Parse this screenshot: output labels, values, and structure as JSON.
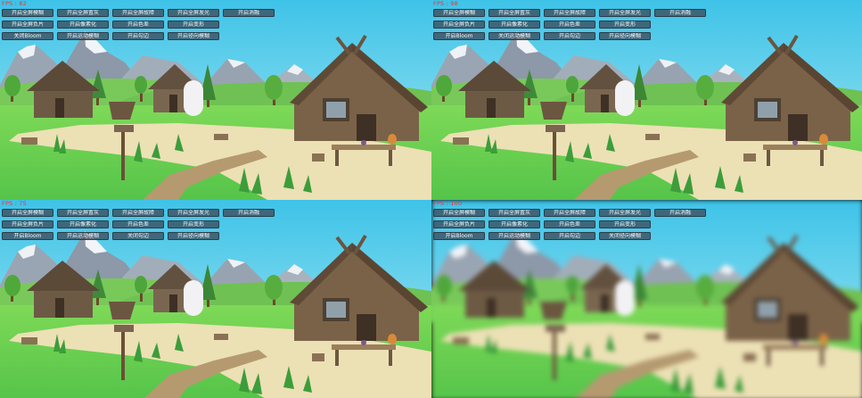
{
  "views": [
    {
      "fps": "FPS : 82",
      "row3": [
        "关闭Bloom",
        "开启运动模糊",
        "开启勾边",
        "开启径向模糊"
      ]
    },
    {
      "fps": "FPS : 98",
      "row3": [
        "开启Bloom",
        "关闭运动模糊",
        "开启勾边",
        "开启径向模糊"
      ]
    },
    {
      "fps": "FPS : 75",
      "row3": [
        "开启Bloom",
        "开启运动模糊",
        "关闭勾边",
        "开启径向模糊"
      ]
    },
    {
      "fps": "FPS : 100",
      "row3": [
        "开启Bloom",
        "开启运动模糊",
        "开启勾边",
        "关闭径向模糊"
      ]
    }
  ],
  "buttons_row1": [
    "开启全屏模糊",
    "开启全屏置灰",
    "开启全屏故障",
    "开启全屏发光",
    "开启消融"
  ],
  "buttons_row2": [
    "开启全屏负片",
    "开启像素化",
    "开启色差",
    "开启变形"
  ],
  "colors": {
    "fps_text": "#ff2d2d",
    "button_bg": "#3e4e5e",
    "button_text": "#f4f6f8"
  }
}
